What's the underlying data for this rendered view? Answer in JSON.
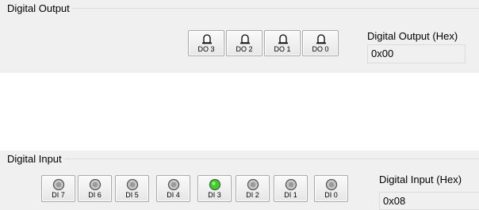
{
  "digital_output": {
    "title": "Digital Output",
    "buttons": [
      {
        "label": "DO 3",
        "icon": "bell-icon"
      },
      {
        "label": "DO 2",
        "icon": "bell-icon"
      },
      {
        "label": "DO 1",
        "icon": "bell-icon"
      },
      {
        "label": "DO 0",
        "icon": "bell-icon"
      }
    ],
    "hex_label": "Digital Output (Hex)",
    "hex_value": "0x00"
  },
  "digital_input": {
    "title": "Digital Input",
    "leds": [
      {
        "label": "DI 7",
        "on": false
      },
      {
        "label": "DI 6",
        "on": false
      },
      {
        "label": "DI 5",
        "on": false
      },
      {
        "label": "DI 4",
        "on": false
      },
      {
        "label": "DI 3",
        "on": true
      },
      {
        "label": "DI 2",
        "on": false
      },
      {
        "label": "DI 1",
        "on": false
      },
      {
        "label": "DI 0",
        "on": false
      }
    ],
    "hex_label": "Digital Input (Hex)",
    "hex_value": "0x08"
  },
  "colors": {
    "led_on": "#39d31f",
    "led_off": "#c8c8c8"
  }
}
